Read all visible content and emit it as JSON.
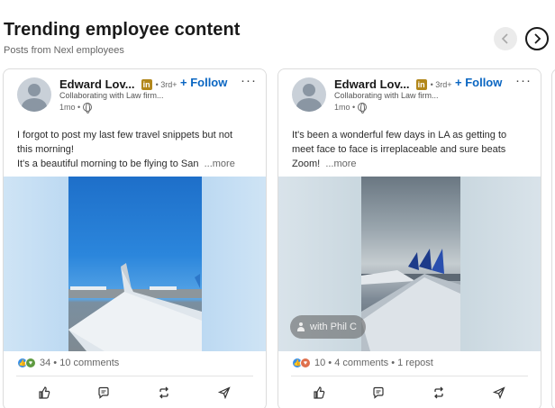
{
  "section": {
    "title": "Trending employee content",
    "subtitle": "Posts from Nexl employees"
  },
  "nav": {
    "prev_icon": "chevron-left-icon",
    "next_icon": "chevron-right-icon"
  },
  "colors": {
    "accent": "#0a66c2",
    "badge": "#b2871b",
    "text": "#191919",
    "muted": "#666666"
  },
  "posts": [
    {
      "author": "Edward Lov...",
      "badge": "in",
      "degree": "• 3rd+",
      "follow_label": "+ Follow",
      "menu_label": "···",
      "headline": "Collaborating with Law firm...",
      "time": "1mo •",
      "text_lines": [
        "I forgot to post my last few travel snippets but not",
        "this morning!",
        "It's a beautiful morning to be flying to San"
      ],
      "see_more": "...more",
      "reaction_count": "34",
      "comments": "10 comments",
      "reposts": ""
    },
    {
      "author": "Edward Lov...",
      "badge": "in",
      "degree": "• 3rd+",
      "follow_label": "+ Follow",
      "menu_label": "···",
      "headline": "Collaborating with Law firm...",
      "time": "1mo •",
      "text_lines": [
        "It's been a wonderful few days in LA as getting to",
        "meet face to face is irreplaceable and sure beats",
        "Zoom!"
      ],
      "see_more": "...more",
      "media_tag": "with Phil C",
      "reaction_count": "10",
      "comments": "4 comments",
      "reposts": "1 repost"
    }
  ],
  "actions": [
    "like-icon",
    "comment-icon",
    "repost-icon",
    "send-icon"
  ]
}
